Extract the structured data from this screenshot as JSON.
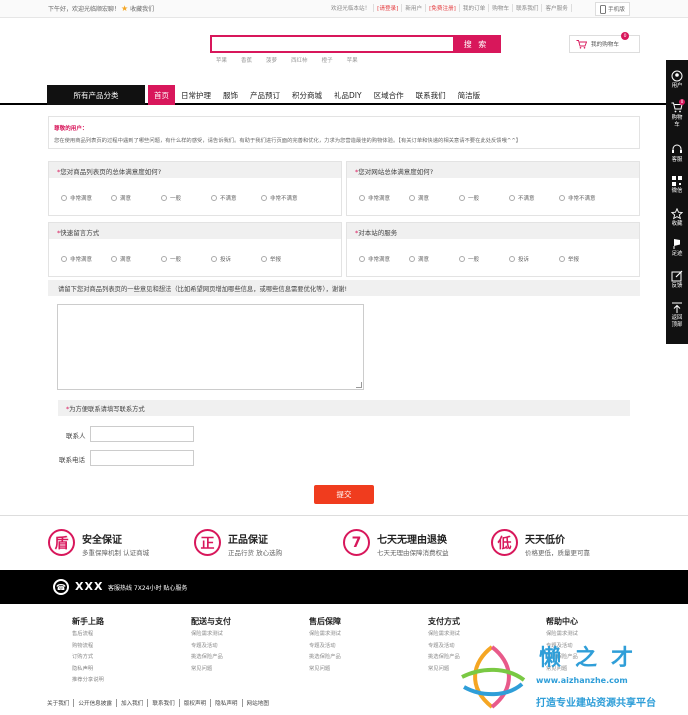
{
  "topbar": {
    "greeting": "下午好，欢迎光临顺宏聊！",
    "favorite": "收藏我们",
    "links": [
      {
        "label": "欢迎光临本站！",
        "red": false
      },
      {
        "label": "[请登录]",
        "red": true
      },
      {
        "label": "新用户",
        "red": false
      },
      {
        "label": "[免费注册]",
        "red": true
      },
      {
        "label": "我的订单",
        "red": false
      },
      {
        "label": "购物车",
        "red": false
      },
      {
        "label": "联系我们",
        "red": false
      },
      {
        "label": "客户服务",
        "red": false
      }
    ],
    "phone": "手机版"
  },
  "search": {
    "button": "搜 索",
    "hotwords": [
      "苹果",
      "香蕉",
      "菠萝",
      "西红柿",
      "橙子",
      "苹果"
    ]
  },
  "cart": {
    "label": "我的购物车",
    "count": "0"
  },
  "nav": {
    "category": "所有产品分类",
    "items": [
      {
        "label": "首页",
        "active": true
      },
      {
        "label": "日常护理",
        "active": false
      },
      {
        "label": "服饰",
        "active": false
      },
      {
        "label": "产品预订",
        "active": false
      },
      {
        "label": "积分商城",
        "active": false
      },
      {
        "label": "礼品DIY",
        "active": false
      },
      {
        "label": "区域合作",
        "active": false
      },
      {
        "label": "联系我们",
        "active": false
      },
      {
        "label": "简洁版",
        "active": false
      }
    ]
  },
  "notice": {
    "title": "尊敬的用户：",
    "body": "您在使用商品列表页的过程中遇到了哪些问题，有什么样的感受，请告诉我们。有助于我们进行页面的完善和优化，力求为您营造最佳的购物体验。【有关订单和快递的相关意请不要在此处反馈哦^^】"
  },
  "survey": {
    "q1": {
      "title": "您对商品列表页的总体满意度如何?",
      "options": [
        "非常满意",
        "满意",
        "一般",
        "不满意",
        "非常不满意"
      ]
    },
    "q2": {
      "title": "您对网站总体满意度如何?",
      "options": [
        "非常满意",
        "满意",
        "一般",
        "不满意",
        "非常不满意"
      ]
    },
    "q3": {
      "title": "快速留言方式",
      "options": [
        "非常满意",
        "满意",
        "一般",
        "投诉",
        "举报"
      ]
    },
    "q4": {
      "title": "对本站的服务",
      "options": [
        "非常满意",
        "满意",
        "一般",
        "投诉",
        "举报"
      ]
    },
    "suggest": "请留下您对商品列表页的一些意见和想法（比如希望网页增加哪些信息，或哪些信息需要优化等），谢谢!",
    "contact_title": "为方便联系请填写联系方式",
    "contact_label": "联系人",
    "phone_label": "联系电话",
    "submit": "提交"
  },
  "guarantees": [
    {
      "icon": "盾",
      "title": "安全保证",
      "desc": "多重保障机制 认证商城"
    },
    {
      "icon": "正",
      "title": "正品保证",
      "desc": "正品行货 放心选购"
    },
    {
      "icon": "7",
      "title": "七天无理由退换",
      "desc": "七天无理由保障消费权益"
    },
    {
      "icon": "低",
      "title": "天天低价",
      "desc": "价格更低，质量更可靠"
    }
  ],
  "hotline": {
    "brand": "XXX",
    "text": "客服热线 7X24小时 贴心服务"
  },
  "footer": {
    "columns": [
      {
        "title": "新手上路",
        "links": [
          "售后流程",
          "购物流程",
          "订购方式",
          "隐私声明",
          "推荐分享说明"
        ]
      },
      {
        "title": "配送与支付",
        "links": [
          "保险需求测试",
          "专题及活动",
          "挑选保险产品",
          "常见问题"
        ]
      },
      {
        "title": "售后保障",
        "links": [
          "保险需求测试",
          "专题及活动",
          "挑选保险产品",
          "常见问题"
        ]
      },
      {
        "title": "支付方式",
        "links": [
          "保险需求测试",
          "专题及活动",
          "挑选保险产品",
          "常见问题"
        ]
      },
      {
        "title": "帮助中心",
        "links": [
          "保险需求测试",
          "专题及活动",
          "挑选保险产品",
          "常见问题"
        ]
      }
    ],
    "bottom_links": [
      "关于我们",
      "公开信息披露",
      "加入我们",
      "联系我们",
      "版权声明",
      "隐私声明",
      "网站地图"
    ]
  },
  "watermark": {
    "brand": "懒之才",
    "url": "www.aizhanzhe.com",
    "slogan": "打造专业建站资源共享平台"
  },
  "rightbar": {
    "items": [
      "用户",
      "购物车",
      "客服",
      "微信",
      "收藏",
      "足迹",
      "反馈",
      "返回顶部"
    ]
  }
}
